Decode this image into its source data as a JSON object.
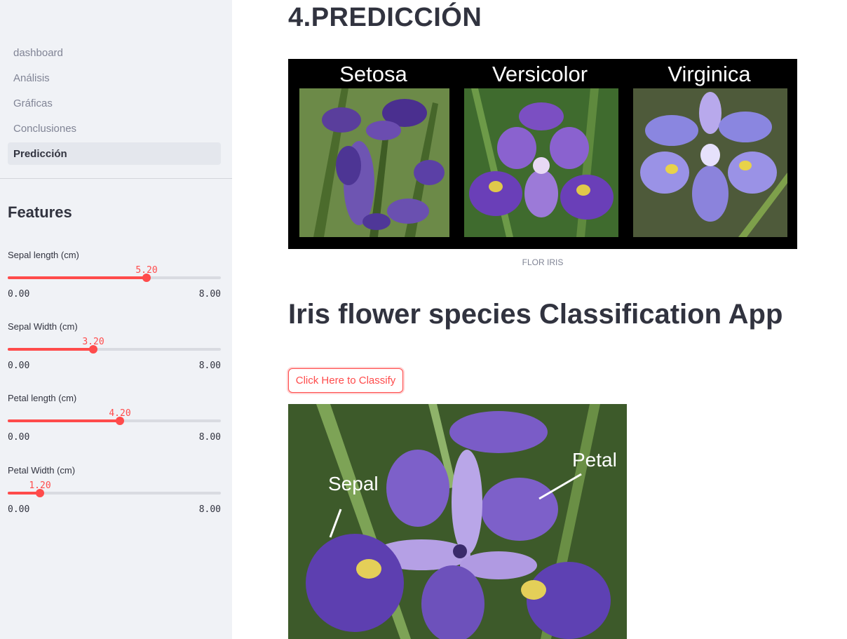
{
  "sidebar": {
    "nav": [
      {
        "label": "dashboard",
        "active": false
      },
      {
        "label": "Análisis",
        "active": false
      },
      {
        "label": "Gráficas",
        "active": false
      },
      {
        "label": "Conclusiones",
        "active": false
      },
      {
        "label": "Predicción",
        "active": true
      }
    ],
    "features_title": "Features",
    "sliders": [
      {
        "label": "Sepal length (cm)",
        "value": "5.20",
        "value_num": 5.2,
        "min": "0.00",
        "max": "8.00"
      },
      {
        "label": "Sepal Width (cm)",
        "value": "3.20",
        "value_num": 3.2,
        "min": "0.00",
        "max": "8.00"
      },
      {
        "label": "Petal length (cm)",
        "value": "4.20",
        "value_num": 4.2,
        "min": "0.00",
        "max": "8.00"
      },
      {
        "label": "Petal Width (cm)",
        "value": "1.20",
        "value_num": 1.2,
        "min": "0.00",
        "max": "8.00"
      }
    ]
  },
  "main": {
    "page_title": "4.PREDICCIÓN",
    "species": [
      "Setosa",
      "Versicolor",
      "Virginica"
    ],
    "image_caption": "FLOR IRIS",
    "app_title": "Iris flower species Classification App",
    "classify_button": "Click Here to Classify",
    "photo_labels": {
      "sepal": "Sepal",
      "petal": "Petal"
    }
  },
  "colors": {
    "accent": "#ff4b4b",
    "sidebar_bg": "#f0f2f6",
    "text": "#31333f"
  }
}
